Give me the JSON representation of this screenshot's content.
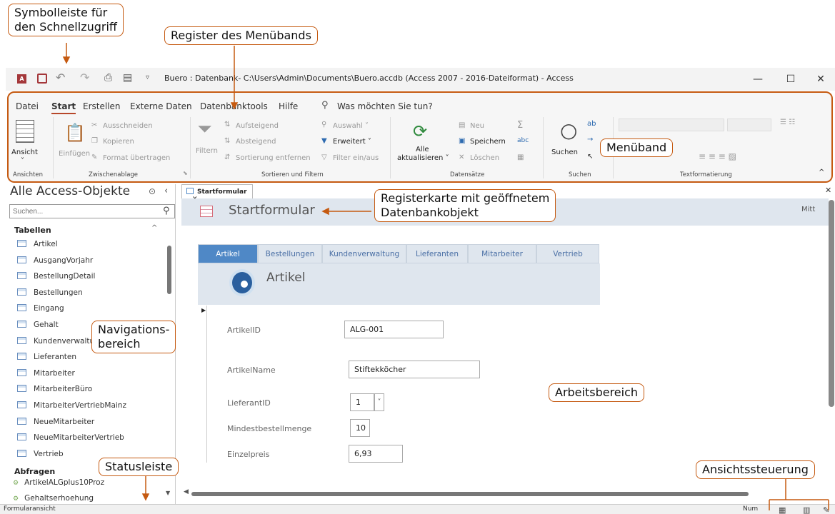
{
  "callouts": {
    "schnellzugriff": "Symbolleiste für\nden Schnellzugriff",
    "register": "Register des Menübands",
    "menueband": "Menüband",
    "registerkarte": "Registerkarte mit geöffnetem\nDatenbankobjekt",
    "navigation": "Navigations-\nbereich",
    "arbeitsbereich": "Arbeitsbereich",
    "statusleiste": "Statusleiste",
    "ansichtssteuerung": "Ansichtssteuerung"
  },
  "window": {
    "title": "Buero : Datenbank- C:\\Users\\Admin\\Documents\\Buero.accdb (Access 2007 - 2016-Dateiformat)  -  Access",
    "minimize": "—",
    "maximize": "☐",
    "close": "✕"
  },
  "ribbon": {
    "tabs": [
      "Datei",
      "Start",
      "Erstellen",
      "Externe Daten",
      "Datenbanktools",
      "Hilfe"
    ],
    "active_tab": "Start",
    "tell_me": "Was möchten Sie tun?",
    "groups": [
      "Ansichten",
      "Zwischenablage",
      "Sortieren und Filtern",
      "Datensätze",
      "Suchen",
      "Textformatierung"
    ],
    "ansicht": "Ansicht",
    "einfuegen": "Einfügen",
    "ausschneiden": "Ausschneiden",
    "kopieren": "Kopieren",
    "format_uebertragen": "Format übertragen",
    "filtern": "Filtern",
    "aufsteigend": "Aufsteigend",
    "absteigend": "Absteigend",
    "sortierung_entfernen": "Sortierung entfernen",
    "auswahl": "Auswahl ˅",
    "erweitert": "Erweitert ˅",
    "filter_ein_aus": "Filter ein/aus",
    "alle": "Alle",
    "aktualisieren": "aktualisieren ˅",
    "neu": "Neu",
    "speichern": "Speichern",
    "loeschen": "Löschen",
    "suchen": "Suchen"
  },
  "nav": {
    "title": "Alle Access-Objekte",
    "search_placeholder": "Suchen...",
    "tabellen_header": "Tabellen",
    "tabellen": [
      "Artikel",
      "AusgangVorjahr",
      "BestellungDetail",
      "Bestellungen",
      "Eingang",
      "Gehalt",
      "Kundenverwaltu",
      "Lieferanten",
      "Mitarbeiter",
      "MitarbeiterBüro",
      "MitarbeiterVertriebMainz",
      "NeueMitarbeiter",
      "NeueMitarbeiterVertrieb",
      "Vertrieb"
    ],
    "abfragen_header": "Abfragen",
    "abfragen": [
      "ArtikelALGplus10Proz",
      "Gehaltserhoehung"
    ]
  },
  "doc": {
    "tab_label": "Startformular",
    "form_title": "Startformular",
    "right_text": "Mitt",
    "tabs": [
      "Artikel",
      "Bestellungen",
      "Kundenverwaltung",
      "Lieferanten",
      "Mitarbeiter",
      "Vertrieb"
    ],
    "active_tab": "Artikel",
    "section_title": "Artikel",
    "fields": [
      {
        "label": "ArtikelID",
        "value": "ALG-001"
      },
      {
        "label": "ArtikelName",
        "value": "Stiftekköcher"
      },
      {
        "label": "LieferantID",
        "value": "1"
      },
      {
        "label": "Mindestbestellmenge",
        "value": "10"
      },
      {
        "label": "Einzelpreis",
        "value": "6,93"
      }
    ]
  },
  "status": {
    "left": "Formularansicht",
    "num": "Num"
  },
  "colors": {
    "accent": "#c55a11",
    "access_red": "#a4373a",
    "tab_blue": "#4f88c6"
  }
}
